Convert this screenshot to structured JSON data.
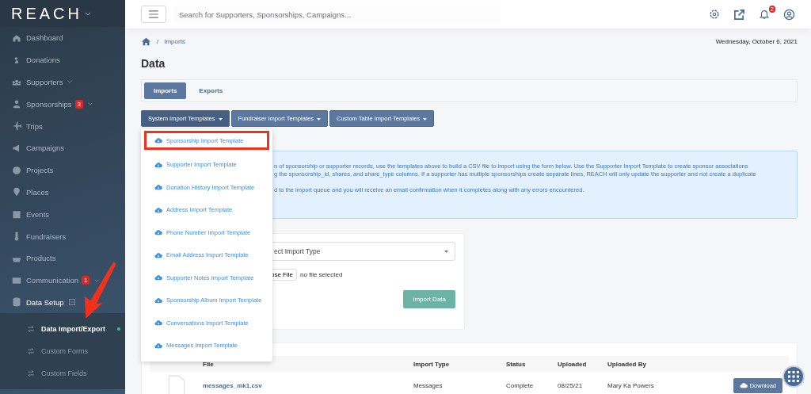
{
  "sidebar": {
    "logo": "REACH",
    "items": [
      {
        "label": "Dashboard"
      },
      {
        "label": "Donations"
      },
      {
        "label": "Supporters",
        "expanded": false
      },
      {
        "label": "Sponsorships",
        "badge": "3",
        "expanded": false
      },
      {
        "label": "Trips"
      },
      {
        "label": "Campaigns"
      },
      {
        "label": "Projects"
      },
      {
        "label": "Places"
      },
      {
        "label": "Events"
      },
      {
        "label": "Fundraisers"
      },
      {
        "label": "Products"
      },
      {
        "label": "Communication",
        "badge": "1",
        "expanded": false
      },
      {
        "label": "Data Setup",
        "expanded": true,
        "children": [
          {
            "label": "Data Import/Export",
            "selected": true
          },
          {
            "label": "Custom Forms",
            "selected": false
          },
          {
            "label": "Custom Fields",
            "selected": false
          }
        ]
      }
    ]
  },
  "topbar": {
    "search": {
      "placeholder": "Search for Supporters, Sponsorships, Campaigns..."
    },
    "notification_count": "2"
  },
  "breadcrumb_separator": "/",
  "breadcrumb": [
    "Imports"
  ],
  "date": "Wednesday, October 6, 2021",
  "title": "Data",
  "tabs": [
    {
      "label": "Imports",
      "selected": true
    },
    {
      "label": "Exports",
      "selected": false
    }
  ],
  "template_buttons": [
    {
      "label": "System Import Templates",
      "expanded": true
    },
    {
      "label": "Fundraiser Import Templates",
      "expanded": false
    },
    {
      "label": "Custom Table Import Templates",
      "expanded": false
    }
  ],
  "dropdown": [
    {
      "label": "Sponsorship Import Template",
      "highlighted": true
    },
    {
      "label": "Supporter Import Template",
      "highlighted": false
    },
    {
      "label": "Donation History Import Template",
      "highlighted": false
    },
    {
      "label": "Address Import Template",
      "highlighted": false
    },
    {
      "label": "Phone Number Import Template",
      "highlighted": false
    },
    {
      "label": "Email Address Import Template",
      "highlighted": false
    },
    {
      "label": "Supporter Notes Import Template",
      "highlighted": false
    },
    {
      "label": "Sponsorship Album Import Template",
      "highlighted": false
    },
    {
      "label": "Conversations Import Template",
      "highlighted": false
    },
    {
      "label": "Messages Import Template",
      "highlighted": false
    }
  ],
  "info": [
    "n of sponsorship or supporter records, use the templates above to build a CSV file to import using the form below. Use the Supporter Import Template to create sponsor associations",
    "g the sponsorship_id, shares, and share_type columns. If a supporter has multiple sponsorships create separate lines, REACH will only update the supporter and not create a duplicate",
    "d to the import queue and you will receive an email confirmation when it completes along with any errors encountered."
  ],
  "form": {
    "import_type": "ect Import Type",
    "file_button": "ose File",
    "file_status": "no file selected",
    "submit": "Import Data"
  },
  "table": {
    "columns": [
      "File",
      "Import Type",
      "Status",
      "Uploaded",
      "Uploaded By"
    ],
    "rows": [
      {
        "file": "messages_mk1.csv",
        "import_type": "Messages",
        "status": "Complete",
        "uploaded": "08/25/21",
        "uploaded_by": "Mary Ka Powers",
        "action": "Download"
      }
    ]
  }
}
